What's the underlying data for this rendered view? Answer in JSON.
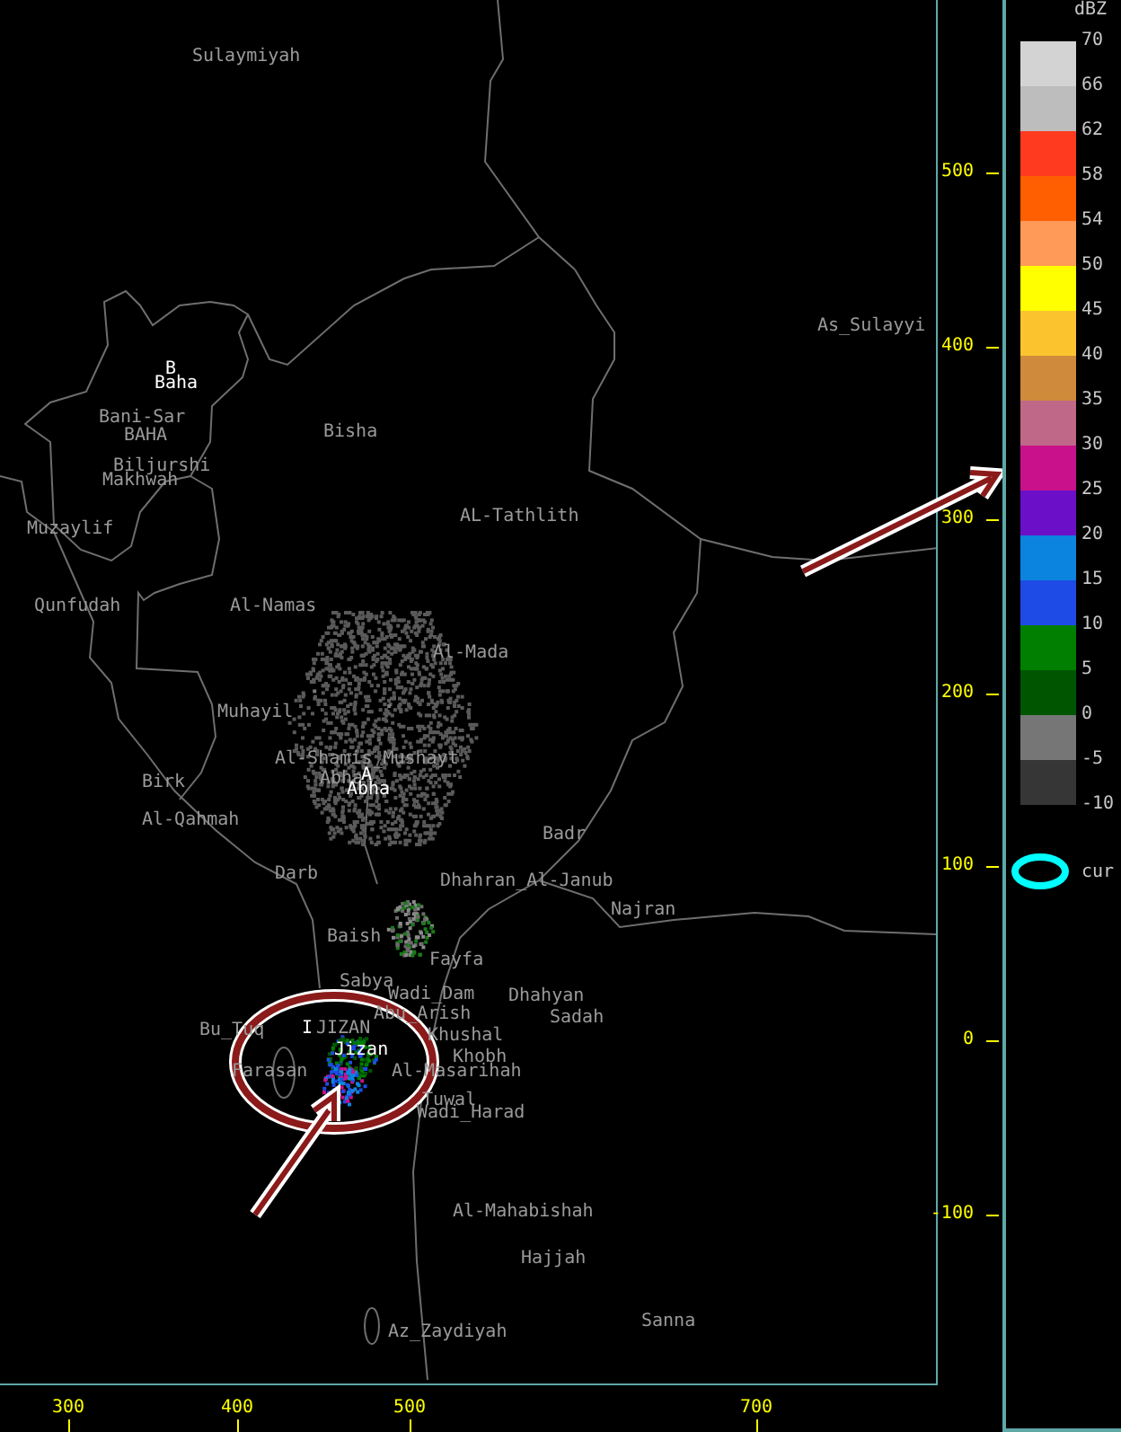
{
  "map": {
    "places": [
      {
        "name": "Sulaymiyah",
        "kind": "city"
      },
      {
        "name": "B",
        "kind": "site"
      },
      {
        "name": "Baha",
        "kind": "site"
      },
      {
        "name": "Bani-Sar",
        "kind": "city"
      },
      {
        "name": "BAHA",
        "kind": "city"
      },
      {
        "name": "Biljurshi",
        "kind": "city"
      },
      {
        "name": "Makhwah",
        "kind": "city"
      },
      {
        "name": "Bisha",
        "kind": "city"
      },
      {
        "name": "Muzaylif",
        "kind": "city"
      },
      {
        "name": "AL-Tathlith",
        "kind": "city"
      },
      {
        "name": "Qunfudah",
        "kind": "city"
      },
      {
        "name": "Al-Namas",
        "kind": "city"
      },
      {
        "name": "Al-Mada",
        "kind": "city"
      },
      {
        "name": "Muhayil",
        "kind": "city"
      },
      {
        "name": "Al-Shamis_Mushayt",
        "kind": "city"
      },
      {
        "name": "Abha",
        "kind": "city"
      },
      {
        "name": "A",
        "kind": "site"
      },
      {
        "name": "Abha",
        "kind": "site"
      },
      {
        "name": "Birk",
        "kind": "city"
      },
      {
        "name": "Al-Qahmah",
        "kind": "city"
      },
      {
        "name": "Badr",
        "kind": "city"
      },
      {
        "name": "Darb",
        "kind": "city"
      },
      {
        "name": "Dhahran_Al-Janub",
        "kind": "city"
      },
      {
        "name": "Najran",
        "kind": "city"
      },
      {
        "name": "Baish",
        "kind": "city"
      },
      {
        "name": "Fayfa",
        "kind": "city"
      },
      {
        "name": "Sabya",
        "kind": "city"
      },
      {
        "name": "Wadi_Dam",
        "kind": "city"
      },
      {
        "name": "Dhahyan",
        "kind": "city"
      },
      {
        "name": "Abu_Arish",
        "kind": "city"
      },
      {
        "name": "Sadah",
        "kind": "city"
      },
      {
        "name": "Bu_Tuq",
        "kind": "city"
      },
      {
        "name": "I",
        "kind": "site"
      },
      {
        "name": "JIZAN",
        "kind": "city"
      },
      {
        "name": "Jizan",
        "kind": "site"
      },
      {
        "name": "Khushal",
        "kind": "city"
      },
      {
        "name": "Khobh",
        "kind": "city"
      },
      {
        "name": "Farasan",
        "kind": "city"
      },
      {
        "name": "Al-Masarihah",
        "kind": "city"
      },
      {
        "name": "Tuwal",
        "kind": "city"
      },
      {
        "name": "Wadi_Harad",
        "kind": "city"
      },
      {
        "name": "Al-Mahabishah",
        "kind": "city"
      },
      {
        "name": "Hajjah",
        "kind": "city"
      },
      {
        "name": "Az_Zaydiyah",
        "kind": "city"
      },
      {
        "name": "Sanna",
        "kind": "city"
      },
      {
        "name": "As_Sulayyi",
        "kind": "city"
      }
    ]
  },
  "y_axis": {
    "ticks": [
      "500",
      "400",
      "300",
      "200",
      "100",
      "0",
      "-100"
    ]
  },
  "x_axis": {
    "ticks": [
      "300",
      "400",
      "500",
      "700"
    ]
  },
  "legend": {
    "title": "dBZ",
    "swatches": [
      {
        "color": "#d3d3d3"
      },
      {
        "color": "#bdbdbd"
      },
      {
        "color": "#ff3a1f"
      },
      {
        "color": "#ff5f00"
      },
      {
        "color": "#ff9a58"
      },
      {
        "color": "#ffff00"
      },
      {
        "color": "#fbc42f"
      },
      {
        "color": "#d08a3c"
      },
      {
        "color": "#bf6888"
      },
      {
        "color": "#c8118a"
      },
      {
        "color": "#6b0fc8"
      },
      {
        "color": "#0a84de"
      },
      {
        "color": "#1e4be6"
      },
      {
        "color": "#007f00"
      },
      {
        "color": "#005600"
      },
      {
        "color": "#767676"
      },
      {
        "color": "#363636"
      }
    ],
    "labels": [
      "70",
      "66",
      "62",
      "58",
      "54",
      "50",
      "45",
      "40",
      "35",
      "30",
      "25",
      "20",
      "15",
      "10",
      "5",
      "0",
      "-5",
      "-10"
    ],
    "marker": {
      "label": "cur"
    }
  }
}
